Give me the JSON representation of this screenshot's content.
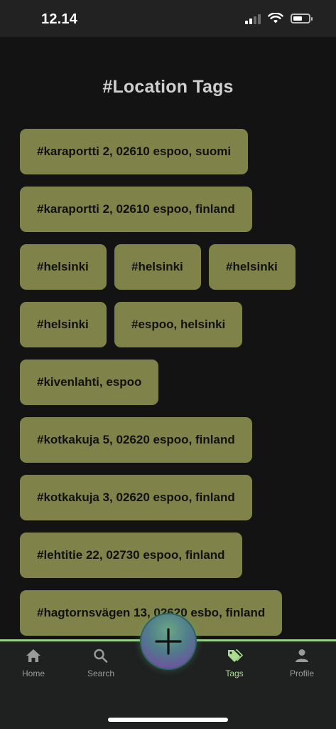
{
  "status_bar": {
    "time": "12.14"
  },
  "page": {
    "title": "#Location Tags"
  },
  "tags": [
    "#karaportti 2, 02610 espoo, suomi",
    "#karaportti 2, 02610 espoo, finland",
    "#helsinki",
    "#helsinki",
    "#helsinki",
    "#helsinki",
    "#espoo, helsinki",
    "#kivenlahti, espoo",
    "#kotkakuja 5, 02620 espoo, finland",
    "#kotkakuja 3, 02620 espoo, finland",
    "#lehtitie 22, 02730 espoo, finland",
    "#hagtornsvägen 13, 02620 esbo, finland"
  ],
  "nav": {
    "home": "Home",
    "search": "Search",
    "tags": "Tags",
    "profile": "Profile",
    "active": "tags"
  },
  "colors": {
    "background": "#131313",
    "tag": "#808349",
    "nav_active": "#a9dd8f"
  }
}
